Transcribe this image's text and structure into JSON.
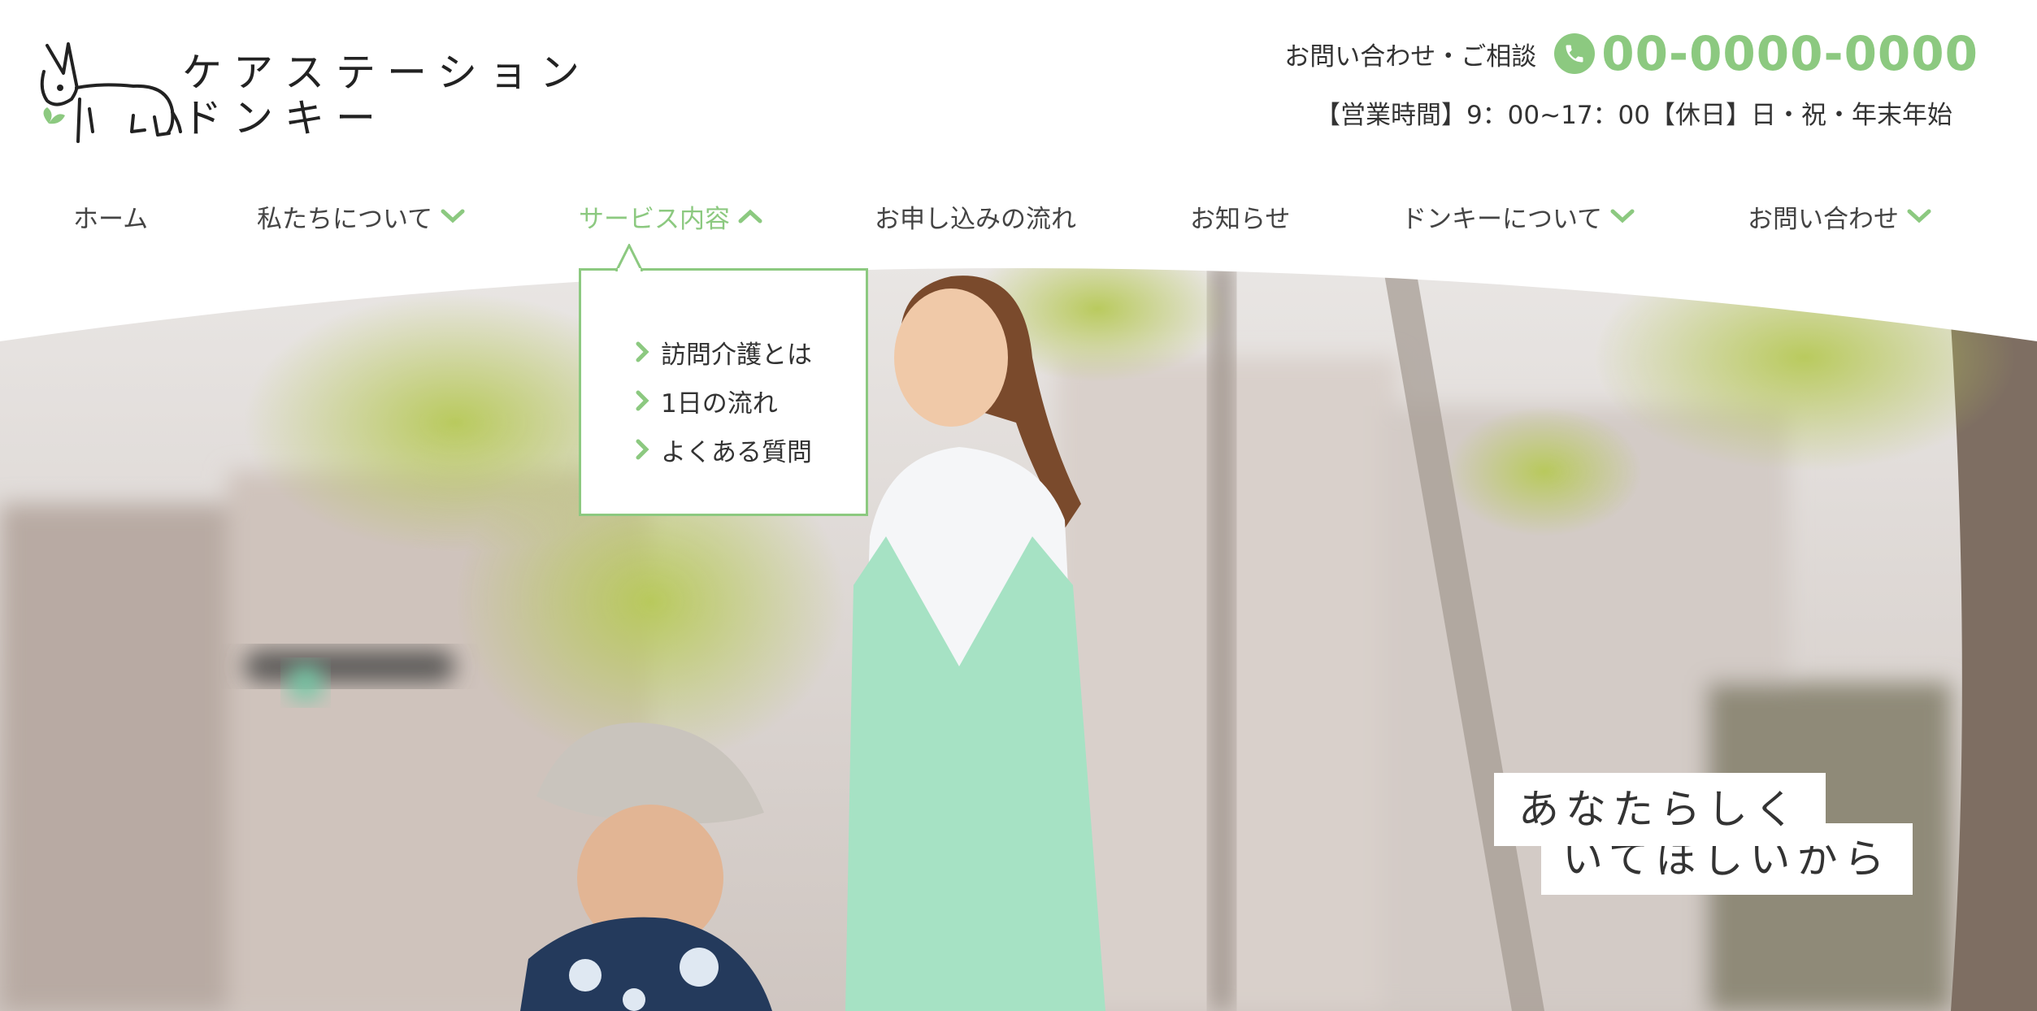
{
  "header": {
    "logo_text_line1": "ケアステーション",
    "logo_text_line2": "ドンキー",
    "contact_label": "お問い合わせ・ご相談",
    "phone_number": "00-0000-0000",
    "business_hours": "【営業時間】9：00~17：00【休日】日・祝・年末年始",
    "icons": [
      "donkey-logo",
      "phone-icon"
    ]
  },
  "nav": {
    "items": [
      {
        "label": "ホーム",
        "has_dropdown": false,
        "active": false
      },
      {
        "label": "私たちについて",
        "has_dropdown": true,
        "active": false
      },
      {
        "label": "サービス内容",
        "has_dropdown": true,
        "active": true
      },
      {
        "label": "お申し込みの流れ",
        "has_dropdown": false,
        "active": false
      },
      {
        "label": "お知らせ",
        "has_dropdown": false,
        "active": false
      },
      {
        "label": "ドンキーについて",
        "has_dropdown": true,
        "active": false
      },
      {
        "label": "お問い合わせ",
        "has_dropdown": true,
        "active": false
      }
    ]
  },
  "dropdown": {
    "items": [
      {
        "label": "訪問介護とは"
      },
      {
        "label": "1日の流れ"
      },
      {
        "label": "よくある質問"
      }
    ]
  },
  "hero": {
    "catch_line1": "あなたらしく",
    "catch_line2": "いてほしいから"
  },
  "colors": {
    "accent": "#8cc980",
    "text": "#333333",
    "background": "#ffffff"
  }
}
